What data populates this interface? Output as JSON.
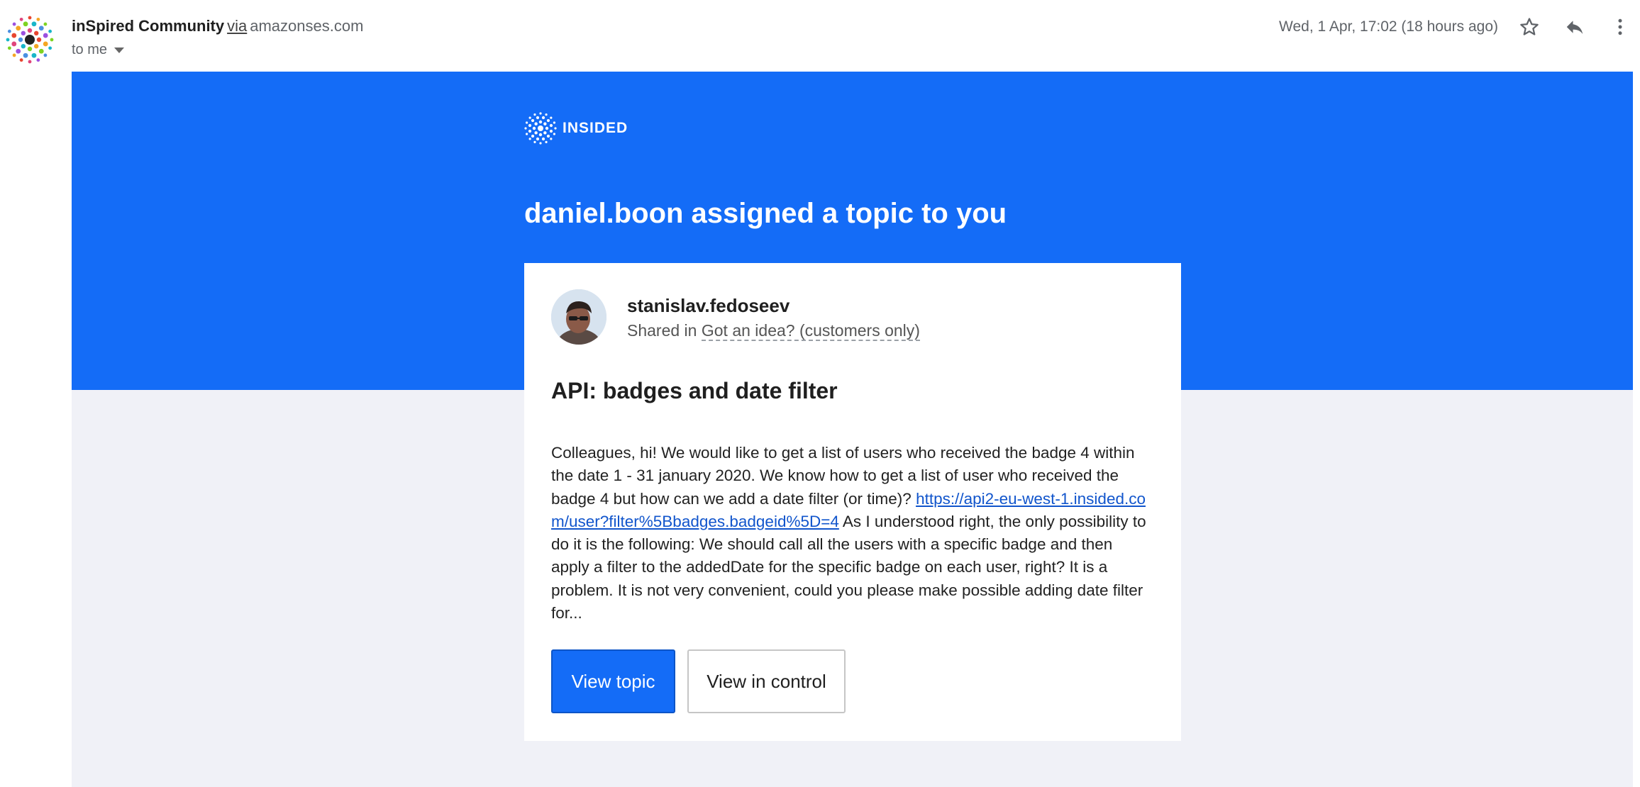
{
  "header": {
    "sender_name": "inSpired Community",
    "via_label": "via",
    "via_domain": "amazonses.com",
    "to_label": "to me",
    "date": "Wed, 1 Apr, 17:02 (18 hours ago)",
    "icons": [
      "star-icon",
      "reply-icon",
      "more-vert-icon",
      "chevron-down-icon"
    ]
  },
  "email": {
    "brand_text": "INSIDED",
    "headline": "daniel.boon assigned a topic to you",
    "author": {
      "name": "stanislav.fedoseev",
      "shared_prefix": "Shared in",
      "shared_category": "Got an idea? (customers only)"
    },
    "topic_title": "API: badges and date filter",
    "body_part1": "Colleagues, hi!   We would like to get a list of users who received the badge 4 within the date 1 - 31 january 2020.   We know how to get a list of user who received the badge 4 but how can we add a date filter (or time)? ",
    "body_link": "https://api2-eu-west-1.insided.com/user?filter%5Bbadges.badgeid%5D=4",
    "body_part2": "   As I understood right, the only possibility to do it is the following: We should call all the users with a specific badge and then apply a filter to the addedDate for the specific badge on each user, right? It is a problem. It is not very convenient, could you please make possible adding date filter for...",
    "buttons": {
      "view_topic": "View topic",
      "view_in_control": "View in control"
    }
  },
  "colors": {
    "banner_blue": "#146cf7",
    "page_bg": "#f0f1f7",
    "link": "#1155cc"
  }
}
